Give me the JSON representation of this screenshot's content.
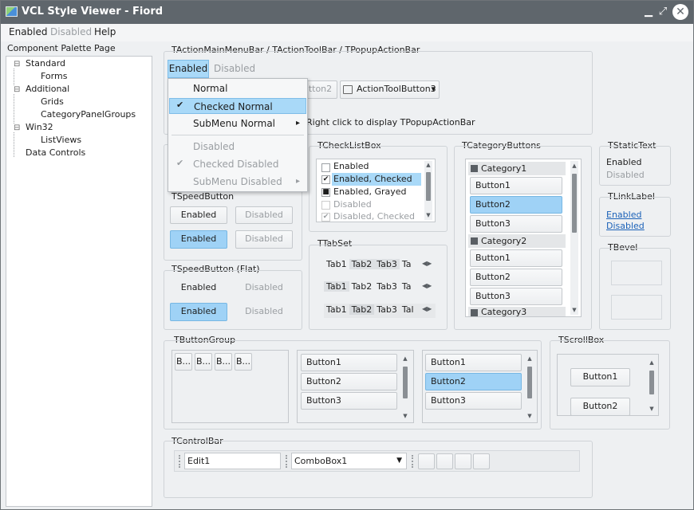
{
  "window": {
    "title": "VCL Style Viewer - Fiord",
    "minimize": "▁",
    "maximize": "⤢",
    "close": "✕"
  },
  "menu": {
    "items": [
      "Enabled",
      "Disabled",
      "Help"
    ]
  },
  "palette": {
    "label": "Component Palette Page",
    "tree": [
      {
        "label": "Standard",
        "toggle": "⊟"
      },
      {
        "label": "Forms"
      },
      {
        "label": "Additional",
        "toggle": "⊟"
      },
      {
        "label": "Grids"
      },
      {
        "label": "CategoryPanelGroups"
      },
      {
        "label": "Win32",
        "toggle": "⊟"
      },
      {
        "label": "ListViews"
      },
      {
        "label": "Data Controls"
      }
    ]
  },
  "actionbar": {
    "label": "TActionMainMenuBar / TActionToolBar / TPopupActionBar",
    "menu_enabled": "Enabled",
    "menu_disabled": "Disabled",
    "button2": "tton2",
    "button3": "ActionToolButton3",
    "hint": "Right click to display TPopupActionBar",
    "dropdown": [
      {
        "label": "Normal"
      },
      {
        "label": "Checked Normal",
        "mark": "✔"
      },
      {
        "label": "SubMenu Normal",
        "arrow": "▸"
      },
      {
        "label": "Disabled"
      },
      {
        "label": "Checked Disabled",
        "mark": "✔"
      },
      {
        "label": "SubMenu Disabled",
        "arrow": "▸"
      }
    ]
  },
  "speedbutton": {
    "label": "TSpeedButton",
    "rows": [
      [
        "Enabled",
        "Disabled"
      ],
      [
        "Enabled",
        "Disabled"
      ]
    ]
  },
  "speedbutton_flat": {
    "label": "TSpeedButton (Flat)",
    "rows": [
      [
        "Enabled",
        "Disabled"
      ],
      [
        "Enabled",
        "Disabled"
      ]
    ]
  },
  "checklistbox": {
    "label": "TCheckListBox",
    "items": [
      {
        "label": "Enabled",
        "state": " "
      },
      {
        "label": "Enabled, Checked",
        "state": "✔"
      },
      {
        "label": "Enabled, Grayed",
        "state": "■"
      },
      {
        "label": "Disabled",
        "state": " "
      },
      {
        "label": "Disabled, Checked",
        "state": "✔"
      }
    ]
  },
  "tabset": {
    "label": "TTabSet",
    "rows": [
      [
        "Tab1",
        "Tab2",
        "Tab3",
        "Ta"
      ],
      [
        "Tab1",
        "Tab2",
        "Tab3",
        "Ta"
      ],
      [
        "Tab1",
        "Tab2",
        "Tab3",
        "Tal"
      ]
    ]
  },
  "categorybuttons": {
    "label": "TCategoryButtons",
    "cat1": "Category1",
    "cat2": "Category2",
    "cat3": "Category3",
    "b1": "Button1",
    "b2": "Button2",
    "b3": "Button3"
  },
  "statictext": {
    "label": "TStaticText",
    "enabled": "Enabled",
    "disabled": "Disabled"
  },
  "linklabel": {
    "label": "TLinkLabel",
    "enabled": "Enabled",
    "disabled": "Disabled"
  },
  "bevel": {
    "label": "TBevel"
  },
  "buttongroup": {
    "label": "TButtonGroup",
    "small": [
      "B...",
      "B...",
      "B...",
      "B..."
    ],
    "list": [
      "Button1",
      "Button2",
      "Button3"
    ]
  },
  "scrollbox": {
    "label": "TScrollBox",
    "b1": "Button1",
    "b2": "Button2"
  },
  "controlbar": {
    "label": "TControlBar",
    "edit": "Edit1",
    "combo": "ComboBox1"
  },
  "glyphs": {
    "up": "▲",
    "down": "▼",
    "left": "◀",
    "right": "▶",
    "dd": "▾"
  }
}
